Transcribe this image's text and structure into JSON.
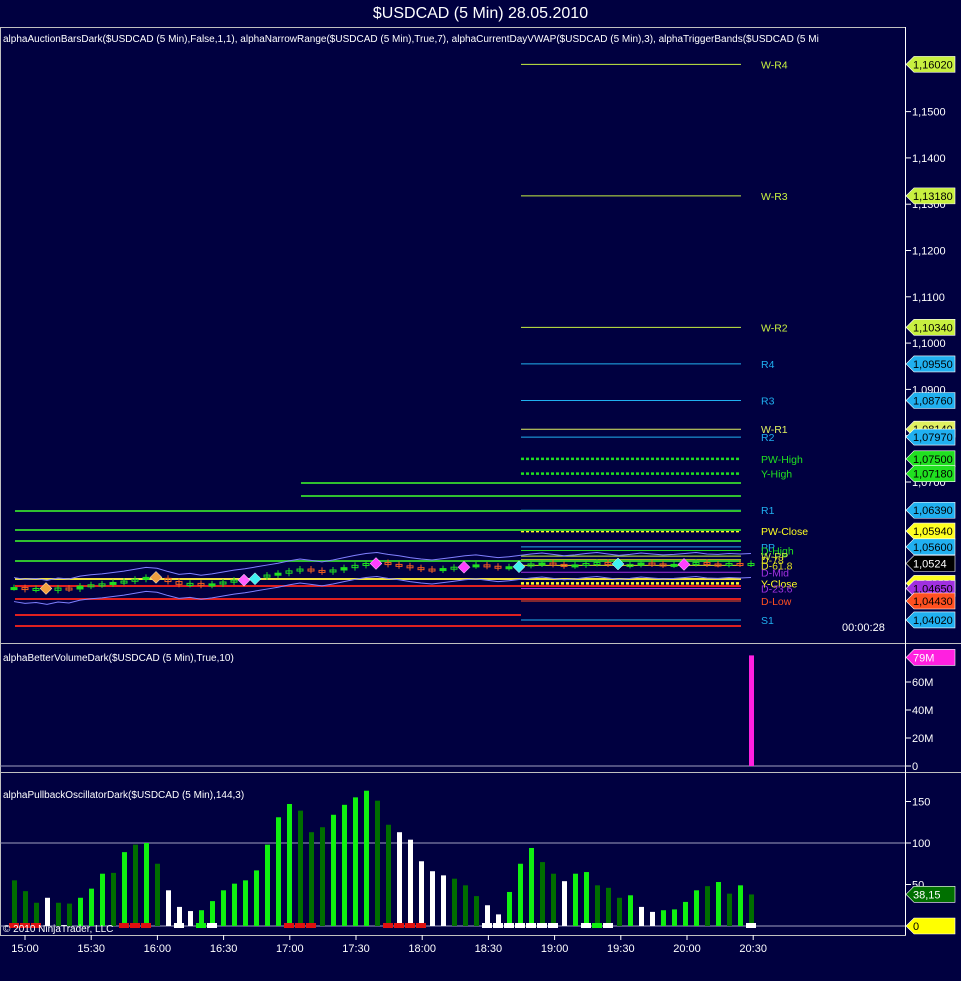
{
  "window": {
    "title": "$USDCAD (5 Min)  28.05.2010"
  },
  "price_panel": {
    "header": "alphaAuctionBarsDark($USDCAD (5 Min),False,1,1), alphaNarrowRange($USDCAD (5 Min),True,7), alphaCurrentDayVWAP($USDCAD (5 Min),3), alphaTriggerBands($USDCAD (5 Mi",
    "axis_labels": [
      "1,1500",
      "1,1400",
      "1,1300",
      "1,1200",
      "1,1100",
      "1,1000",
      "1,0900",
      "1,0800",
      "1,0700"
    ],
    "axis_values": [
      1.15,
      1.14,
      1.13,
      1.12,
      1.11,
      1.1,
      1.09,
      1.08,
      1.07
    ],
    "timer": "00:00:28",
    "levels": [
      {
        "name": "W-R4",
        "price": 1.1602,
        "tag": "1,16020",
        "color": "#c8f040",
        "dotted": false
      },
      {
        "name": "W-R3",
        "price": 1.1318,
        "tag": "1,13180",
        "color": "#c8f040",
        "dotted": false
      },
      {
        "name": "W-R2",
        "price": 1.1034,
        "tag": "1,10340",
        "color": "#c8f040",
        "dotted": false
      },
      {
        "name": "R4",
        "price": 1.0955,
        "tag": "1,09550",
        "color": "#20b0f0",
        "dotted": false
      },
      {
        "name": "R3",
        "price": 1.0876,
        "tag": "1,08760",
        "color": "#20b0f0",
        "dotted": false
      },
      {
        "name": "W-R1",
        "price": 1.0814,
        "tag": "1,08140",
        "color": "#e0f060",
        "dotted": false
      },
      {
        "name": "R2",
        "price": 1.0797,
        "tag": "1,07970",
        "color": "#20b0f0",
        "dotted": false
      },
      {
        "name": "PW-High",
        "price": 1.075,
        "tag": "1,07500",
        "color": "#20e020",
        "dotted": true
      },
      {
        "name": "Y-High",
        "price": 1.0718,
        "tag": "1,07180",
        "color": "#20e020",
        "dotted": true
      },
      {
        "name": "R1",
        "price": 1.0639,
        "tag": "1,06390",
        "color": "#20b0f0",
        "dotted": false
      },
      {
        "name": "PW-Close",
        "price": 1.0594,
        "tag": "1,05940",
        "color": "#ffff20",
        "dotted": true
      },
      {
        "name": "PP",
        "price": 1.056,
        "tag": "1,05600",
        "color": "#20b0f0",
        "dotted": false
      },
      {
        "name": "D-High",
        "price": 1.0552,
        "tag": "",
        "color": "#20e020",
        "dotted": false
      },
      {
        "name": "W-PP",
        "price": 1.054,
        "tag": "",
        "color": "#c8f040",
        "dotted": false
      },
      {
        "name": "D-78",
        "price": 1.0532,
        "tag": "",
        "color": "#e0e020",
        "dotted": false
      },
      {
        "name": "D-61.8",
        "price": 1.052,
        "tag": "",
        "color": "#e0e020",
        "dotted": false
      },
      {
        "name": "D-Mid",
        "price": 1.0505,
        "tag": "",
        "color": "#a030e0",
        "dotted": false
      },
      {
        "name": "Y-Close",
        "price": 1.0481,
        "tag": "1,04810",
        "color": "#ffff20",
        "dotted": true
      },
      {
        "name": "D-23.6",
        "price": 1.047,
        "tag": "1,04650",
        "color": "#a030e0",
        "dotted": false
      },
      {
        "name": "D-Low",
        "price": 1.0443,
        "tag": "1,04430",
        "color": "#ff5020",
        "dotted": false
      },
      {
        "name": "S1",
        "price": 1.0402,
        "tag": "1,04020",
        "color": "#20b0f0",
        "dotted": false
      }
    ],
    "current_price": "1,0524",
    "closes": [
      1.0472,
      1.0468,
      1.047,
      1.0466,
      1.0471,
      1.0469,
      1.0475,
      1.0478,
      1.048,
      1.0483,
      1.0486,
      1.049,
      1.0494,
      1.0492,
      1.0485,
      1.0479,
      1.0481,
      1.0477,
      1.048,
      1.0484,
      1.0488,
      1.0491,
      1.0495,
      1.0499,
      1.0503,
      1.0508,
      1.0512,
      1.0509,
      1.0506,
      1.051,
      1.0515,
      1.052,
      1.0524,
      1.0526,
      1.0522,
      1.0519,
      1.0515,
      1.0512,
      1.051,
      1.0513,
      1.0516,
      1.0519,
      1.0521,
      1.0518,
      1.0515,
      1.0517,
      1.052,
      1.0523,
      1.0525,
      1.0522,
      1.0519,
      1.0521,
      1.0524,
      1.0526,
      1.0523,
      1.052,
      1.0522,
      1.0525,
      1.0523,
      1.0521,
      1.0522,
      1.0524,
      1.0526,
      1.0523,
      1.0522,
      1.0524,
      1.0523,
      1.0524
    ]
  },
  "volume_panel": {
    "header": "alphaBetterVolumeDark($USDCAD (5 Min),True,10)",
    "axis_labels": [
      "60M",
      "40M",
      "20M",
      "0"
    ],
    "axis_values": [
      60,
      40,
      20,
      0
    ],
    "last_volume_tag": "79M",
    "last_volume": 79,
    "color": "#ff20e0"
  },
  "oscillator_panel": {
    "header": "alphaPullbackOscillatorDark($USDCAD (5 Min),144,3)",
    "axis_labels": [
      "150",
      "100",
      "50"
    ],
    "axis_values": [
      150,
      100,
      50
    ],
    "value_tag": "38,15",
    "zero_tag": "0",
    "values": [
      55,
      42,
      28,
      34,
      28,
      27,
      34,
      45,
      63,
      64,
      89,
      98,
      100,
      75,
      43,
      23,
      18,
      19,
      30,
      43,
      51,
      55,
      67,
      98,
      131,
      147,
      139,
      113,
      119,
      134,
      146,
      155,
      163,
      151,
      122,
      113,
      104,
      78,
      66,
      61,
      57,
      49,
      36,
      25,
      14,
      41,
      75,
      94,
      77,
      63,
      54,
      63,
      65,
      49,
      46,
      34,
      37,
      23,
      17,
      19,
      20,
      29,
      43,
      48,
      53,
      39,
      49,
      38
    ],
    "colors": "DDDWDDBBBDBDBDWWWBBBBBBBBBDDDBBBBDDWWWWWDDDWWBBBDDWBBDDDBWWBBBBDBDBD",
    "markers": "RRR.......RRR..W.GW......RRR......RRRR.....WWWWWWW..WGW............WWW.......",
    "bar_colors": {
      "B": "#10f010",
      "D": "#006e00",
      "W": "#ffffff"
    }
  },
  "x_axis": {
    "labels": [
      "15:00",
      "15:30",
      "16:00",
      "16:30",
      "17:00",
      "17:30",
      "18:00",
      "18:30",
      "19:00",
      "19:30",
      "20:00",
      "20:30"
    ]
  },
  "copyright": "© 2010 NinjaTrader, LLC"
}
